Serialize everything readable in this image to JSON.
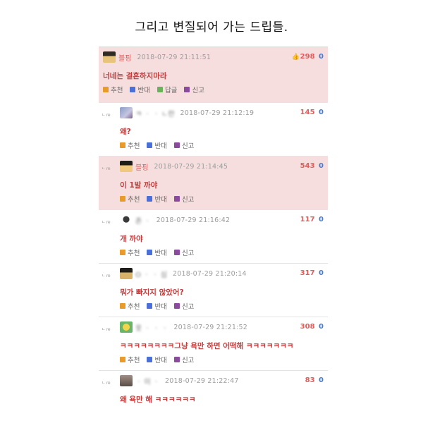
{
  "caption": "그리고 변질되어 가는 드립들.",
  "labels": {
    "recommend": "추천",
    "oppose": "반대",
    "reply": "답글",
    "report": "신고",
    "reply_mark": "ㄴ re"
  },
  "best": {
    "nickname": "블핑",
    "date": "2018-07-29 21:11:51",
    "up": "298",
    "down": "0",
    "text": "너네는 결혼하지마라"
  },
  "replies": [
    {
      "nickname": "ㅋ  ㆍ ㆍ  ㄴ란",
      "date": "2018-07-29 21:12:19",
      "score": "145",
      "down": "0",
      "text": "왜?",
      "best": false
    },
    {
      "nickname": "블핑",
      "date": "2018-07-29 21:14:45",
      "score": "543",
      "down": "0",
      "text": "이   1발   까야",
      "best": true
    },
    {
      "nickname": "존  ㆍ",
      "date": "2018-07-29 21:16:42",
      "score": "117",
      "down": "0",
      "text": "개   까야",
      "best": false
    },
    {
      "nickname": "O ㆍ  ㆍ 심",
      "date": "2018-07-29 21:20:14",
      "score": "317",
      "down": "0",
      "text": "뭐가 빠지지 않았어?",
      "best": false
    },
    {
      "nickname": "옷 ㆍ  ㆍ  ㆍ",
      "date": "2018-07-29 21:21:52",
      "score": "308",
      "down": "0",
      "text": "ㅋㅋㅋㅋㅋㅋㅋㅋ그냥 욕만 하면 어떡해 ㅋㅋㅋㅋㅋㅋㅋ",
      "best": false
    },
    {
      "nickname": "ㆍ 이 ㆍ",
      "date": "2018-07-29 21:22:47",
      "score": "83",
      "down": "0",
      "text": "왜 욕만 해 ㅋㅋㅋㅋㅋㅋ",
      "best": false
    }
  ],
  "colors": {
    "best_bg": "#f7dede",
    "nick": "#e15c5c",
    "body": "#c03d3d",
    "down": "#4a7bd3"
  }
}
